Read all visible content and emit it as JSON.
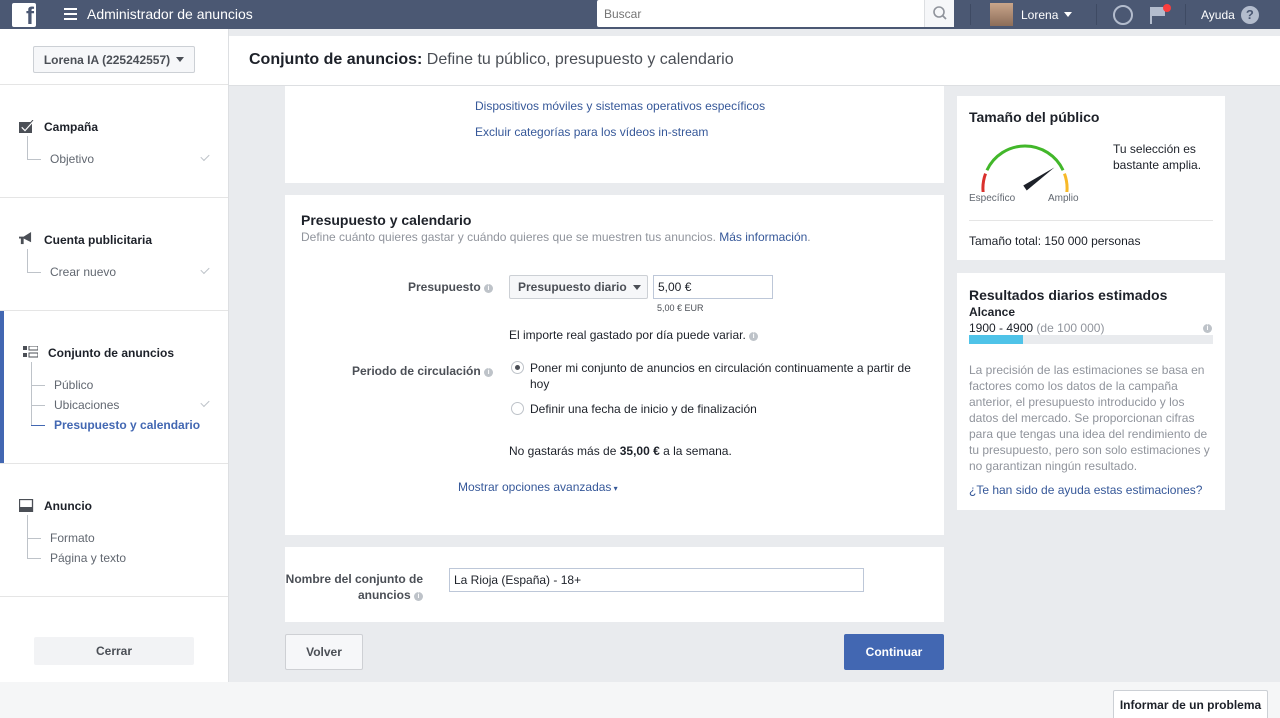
{
  "topbar": {
    "logo": "f",
    "app_title": "Administrador de anuncios",
    "search_placeholder": "Buscar",
    "user_name": "Lorena",
    "help_label": "Ayuda",
    "help_icon": "?"
  },
  "sidebar": {
    "account_selector": "Lorena IA (225242557)",
    "sections": [
      {
        "title": "Campaña",
        "icon": "campaign-check-icon",
        "items": [
          {
            "label": "Objetivo",
            "done": true
          }
        ]
      },
      {
        "title": "Cuenta publicitaria",
        "icon": "megaphone-icon",
        "items": [
          {
            "label": "Crear nuevo",
            "done": true
          }
        ]
      },
      {
        "title": "Conjunto de anuncios",
        "icon": "grid-icon",
        "items": [
          {
            "label": "Público",
            "done": false
          },
          {
            "label": "Ubicaciones",
            "done": true
          },
          {
            "label": "Presupuesto y calendario",
            "done": false,
            "active": true
          }
        ]
      },
      {
        "title": "Anuncio",
        "icon": "ad-icon",
        "items": [
          {
            "label": "Formato",
            "done": false
          },
          {
            "label": "Página y texto",
            "done": false
          }
        ]
      }
    ],
    "close_button": "Cerrar"
  },
  "header": {
    "title_bold": "Conjunto de anuncios:",
    "title_rest": " Define tu público, presupuesto y calendario"
  },
  "placements": {
    "link_devices": "Dispositivos móviles y sistemas operativos específicos",
    "link_exclude": "Excluir categorías para los vídeos in-stream"
  },
  "budget": {
    "title": "Presupuesto y calendario",
    "description": "Define cuánto quieres gastar y cuándo quieres que se muestren tus anuncios.",
    "more_info": "Más información",
    "budget_label": "Presupuesto",
    "budget_type": "Presupuesto diario",
    "budget_value": "5,00 €",
    "budget_hint": "5,00 € EUR",
    "variance_note": "El importe real gastado por día puede variar.",
    "schedule_label": "Periodo de circulación",
    "option_continuous": "Poner mi conjunto de anuncios en circulación continuamente a partir de",
    "option_continuous_2": "hoy",
    "option_dates": "Definir una fecha de inicio y de finalización",
    "weekly_prefix": "No gastarás más de ",
    "weekly_amount": "35,00 €",
    "weekly_suffix": " a la semana.",
    "advanced": "Mostrar opciones avanzadas"
  },
  "name_card": {
    "label_1": "Nombre del conjunto de",
    "label_2": "anuncios",
    "value": "La Rioja (España) - 18+"
  },
  "actions": {
    "back": "Volver",
    "continue": "Continuar"
  },
  "audience": {
    "title": "Tamaño del público",
    "gauge_level": 0.75,
    "gauge_min_label": "Específico",
    "gauge_max_label": "Amplio",
    "verdict_1": "Tu selección es",
    "verdict_2": "bastante amplia.",
    "total": "Tamaño total: 150 000 personas"
  },
  "estimates": {
    "title": "Resultados diarios estimados",
    "reach_label": "Alcance",
    "reach_range": "1900 - 4900",
    "reach_of": " (de 100 000)",
    "reach_fraction": 0.22,
    "disclaimer": [
      "La precisión de las estimaciones se basa en",
      "factores como los datos de la campaña",
      "anterior, el presupuesto introducido y los",
      "datos del mercado. Se proporcionan cifras",
      "para que tengas una idea del rendimiento de",
      "tu presupuesto, pero son solo estimaciones y",
      "no garantizan ningún resultado."
    ],
    "feedback_link": "¿Te han sido de ayuda estas estimaciones?"
  },
  "report_problem": "Informar de un problema",
  "colors": {
    "topbar": "#4b5873",
    "accent": "#4267b2",
    "gauge_red": "#d9302c",
    "gauge_green": "#42b72a",
    "gauge_orange": "#f7b928",
    "reach_bar": "#4fc3e8"
  }
}
